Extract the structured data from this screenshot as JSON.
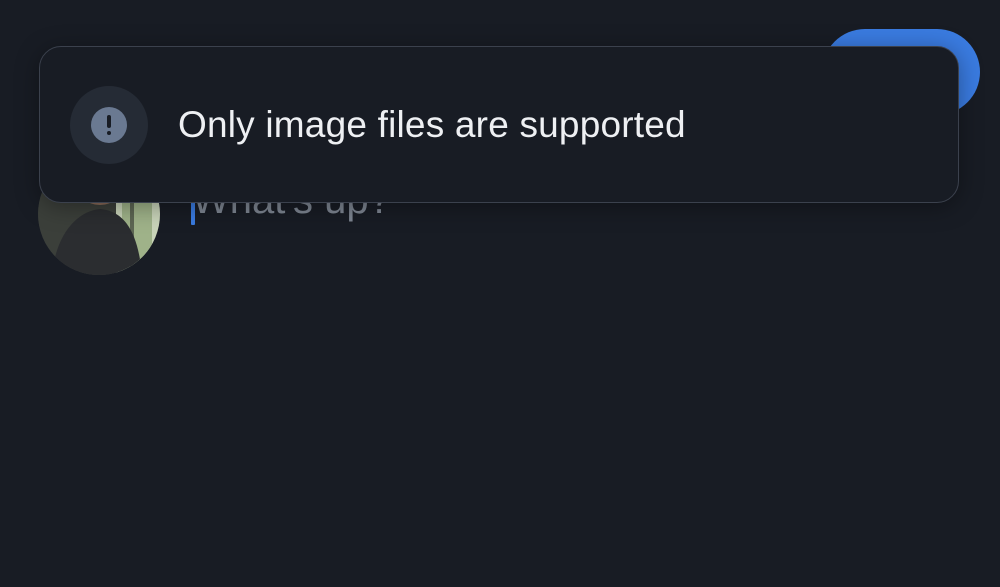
{
  "composer": {
    "placeholder": "What's up?",
    "avatar_alt": "user avatar"
  },
  "toolbar": {
    "post_label": ""
  },
  "toast": {
    "icon": "exclamation-circle-icon",
    "message": "Only image files are supported"
  },
  "colors": {
    "background": "#181c24",
    "accent": "#3a7be0",
    "toast_border": "#3b414d",
    "icon_fill": "#6a7991"
  }
}
